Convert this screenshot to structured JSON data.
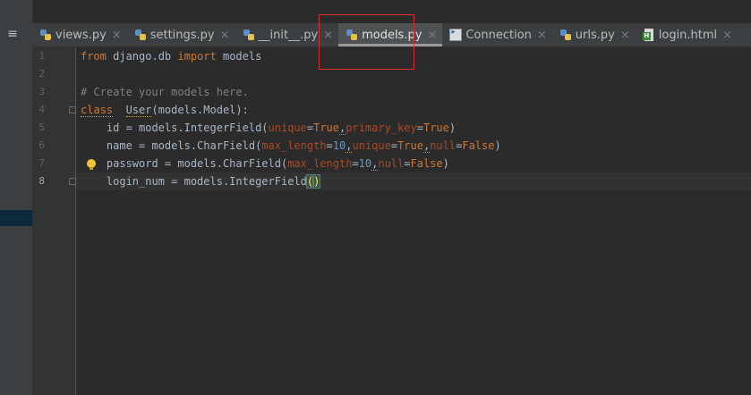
{
  "left_strip": {
    "menu_glyph": "≡"
  },
  "tabs": [
    {
      "label": "views.py",
      "icon": "python-file-icon",
      "active": false
    },
    {
      "label": "settings.py",
      "icon": "python-file-icon",
      "active": false
    },
    {
      "label": "__init__.py",
      "icon": "python-file-icon",
      "active": false
    },
    {
      "label": "models.py",
      "icon": "python-file-icon",
      "active": true
    },
    {
      "label": "Connection",
      "icon": "connection-file-icon",
      "active": false
    },
    {
      "label": "urls.py",
      "icon": "python-file-icon",
      "active": false
    },
    {
      "label": "login.html",
      "icon": "html-file-icon",
      "active": false
    }
  ],
  "close_glyph": "×",
  "line_numbers": [
    "1",
    "2",
    "3",
    "4",
    "5",
    "6",
    "7",
    "8"
  ],
  "code": {
    "l1": {
      "kw1": "from",
      "mod": " django.db ",
      "kw2": "import",
      "rest": " models"
    },
    "l3": {
      "comment": "# Create your models here."
    },
    "l4": {
      "kw": "class",
      "sp": "  ",
      "name": "User",
      "rest": "(models.Model):"
    },
    "l5": {
      "a": "    id = models.IntegerField(",
      "p1": "unique",
      "eq1": "=",
      "v1": "True",
      "c1": ",",
      "p2": "primary_key",
      "eq2": "=",
      "v2": "True",
      "end": ")"
    },
    "l6": {
      "a": "    name = models.CharField(",
      "p1": "max_length",
      "eq1": "=",
      "v1": "10",
      "c1": ",",
      "p2": "unique",
      "eq2": "=",
      "v2": "True",
      "c2": ",",
      "p3": "null",
      "eq3": "=",
      "v3": "False",
      "end": ")"
    },
    "l7": {
      "a": "    password = models.CharField(",
      "p1": "max_length",
      "eq1": "=",
      "v1": "10",
      "c1": ",",
      "p2": "null",
      "eq2": "=",
      "v2": "False",
      "end": ")"
    },
    "l8": {
      "a": "    login_num = models.IntegerField",
      "open": "(",
      "close": ")"
    }
  },
  "colors": {
    "background": "#2b2b2b",
    "keyword": "#cc7832",
    "comment": "#808080",
    "param": "#aa4926",
    "highlight_box": "#d62f2f"
  }
}
